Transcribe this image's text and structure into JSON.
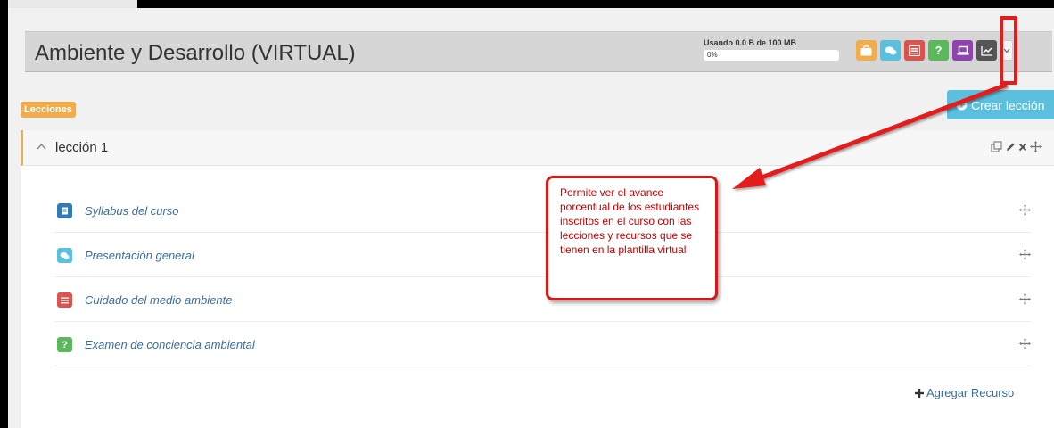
{
  "course": {
    "title": "Ambiente y Desarrollo (VIRTUAL)",
    "usage_label": "Usando 0.0 B de 100 MB",
    "usage_percent_text": "0%",
    "usage_fraction": 0.0
  },
  "toolbar": {
    "buttons": [
      {
        "icon": "briefcase-icon",
        "color": "#f0ad4e"
      },
      {
        "icon": "chat-bubbles-icon",
        "color": "#5bc0de"
      },
      {
        "icon": "list-icon",
        "color": "#d9534f"
      },
      {
        "icon": "question-icon",
        "color": "#5cb85c",
        "text": "?"
      },
      {
        "icon": "laptop-icon",
        "color": "#8e44ad"
      },
      {
        "icon": "line-chart-icon",
        "color": "#555555"
      },
      {
        "icon": "chevron-down-icon",
        "color": "#f4f4f4"
      }
    ]
  },
  "lessons_badge": "Lecciones",
  "create_lesson_label": "Crear lección",
  "lesson": {
    "title": "lección 1",
    "resources": [
      {
        "label": "Syllabus del curso",
        "icon": "book-icon",
        "color": "#337ab7"
      },
      {
        "label": "Presentación general",
        "icon": "chat-bubbles-icon",
        "color": "#5bc0de"
      },
      {
        "label": "Cuidado del medio ambiente",
        "icon": "list-icon",
        "color": "#d9534f"
      },
      {
        "label": "Examen de conciencia ambiental",
        "icon": "question-icon",
        "color": "#5cb85c",
        "text": "?"
      }
    ],
    "add_resource_label": "Agregar Recurso"
  },
  "callout": {
    "text": "Permite ver el avance porcentual de los estudiantes inscritos en el curso con las lecciones y recursos que se tienen en la plantilla virtual"
  },
  "colors": {
    "accent_orange": "#f0ad4e",
    "accent_blue": "#5bc0de",
    "annotation_red": "#e31c1c"
  }
}
